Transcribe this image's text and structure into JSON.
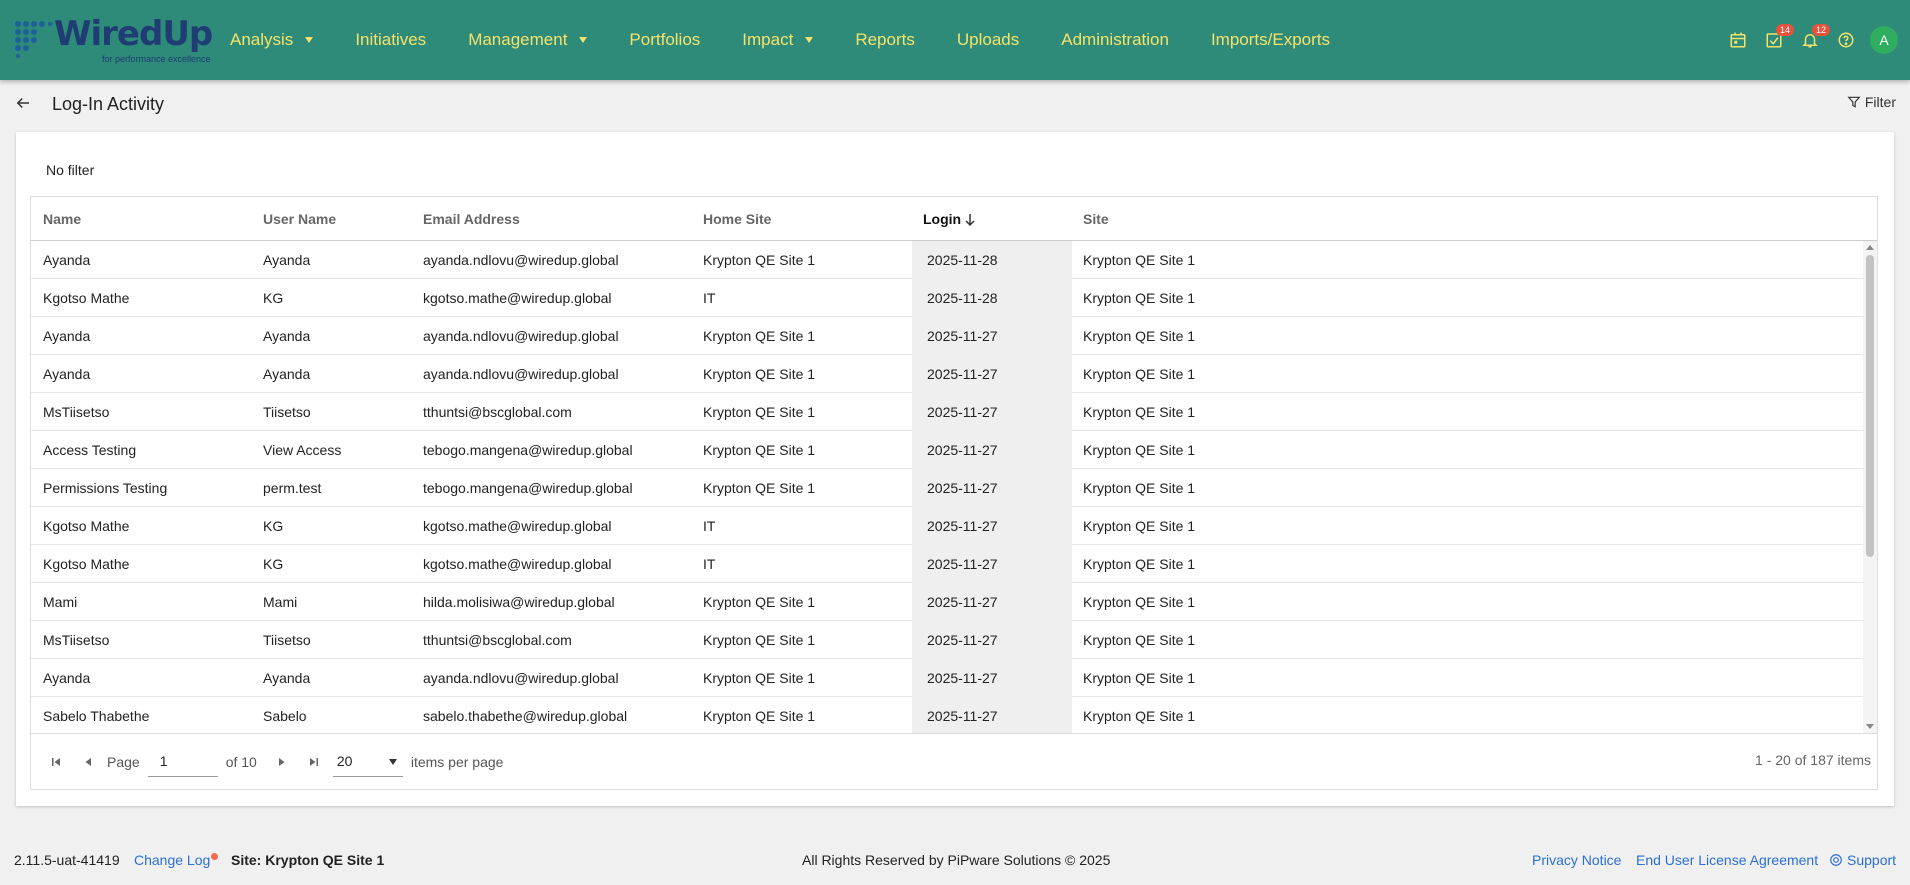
{
  "logo": {
    "text": "WiredUp",
    "tagline": "for performance excellence"
  },
  "nav": [
    {
      "label": "Analysis",
      "dropdown": true
    },
    {
      "label": "Initiatives",
      "dropdown": false
    },
    {
      "label": "Management",
      "dropdown": true
    },
    {
      "label": "Portfolios",
      "dropdown": false
    },
    {
      "label": "Impact",
      "dropdown": true
    },
    {
      "label": "Reports",
      "dropdown": false
    },
    {
      "label": "Uploads",
      "dropdown": false
    },
    {
      "label": "Administration",
      "dropdown": false
    },
    {
      "label": "Imports/Exports",
      "dropdown": false
    }
  ],
  "header_icons": {
    "calendar": "calendar-icon",
    "tasks": {
      "icon": "task-check-icon",
      "badge": "14"
    },
    "notifications": {
      "icon": "bell-icon",
      "badge": "12"
    },
    "help": "help-icon",
    "avatar_initial": "A"
  },
  "page": {
    "title": "Log-In Activity",
    "filter_label": "Filter",
    "filter_state": "No filter"
  },
  "table": {
    "columns": [
      {
        "label": "Name",
        "sorted": false
      },
      {
        "label": "User Name",
        "sorted": false
      },
      {
        "label": "Email Address",
        "sorted": false
      },
      {
        "label": "Home Site",
        "sorted": false
      },
      {
        "label": "Login",
        "sorted": true,
        "direction": "descending"
      },
      {
        "label": "Site",
        "sorted": false
      }
    ],
    "rows": [
      [
        "Ayanda",
        "Ayanda",
        "ayanda.ndlovu@wiredup.global",
        "Krypton QE Site 1",
        "2025-11-28",
        "Krypton QE Site 1"
      ],
      [
        "Kgotso Mathe",
        "KG",
        "kgotso.mathe@wiredup.global",
        "IT",
        "2025-11-28",
        "Krypton QE Site 1"
      ],
      [
        "Ayanda",
        "Ayanda",
        "ayanda.ndlovu@wiredup.global",
        "Krypton QE Site 1",
        "2025-11-27",
        "Krypton QE Site 1"
      ],
      [
        "Ayanda",
        "Ayanda",
        "ayanda.ndlovu@wiredup.global",
        "Krypton QE Site 1",
        "2025-11-27",
        "Krypton QE Site 1"
      ],
      [
        "MsTiisetso",
        "Tiisetso",
        "tthuntsi@bscglobal.com",
        "Krypton QE Site 1",
        "2025-11-27",
        "Krypton QE Site 1"
      ],
      [
        "Access Testing",
        "View Access",
        "tebogo.mangena@wiredup.global",
        "Krypton QE Site 1",
        "2025-11-27",
        "Krypton QE Site 1"
      ],
      [
        "Permissions Testing",
        "perm.test",
        "tebogo.mangena@wiredup.global",
        "Krypton QE Site 1",
        "2025-11-27",
        "Krypton QE Site 1"
      ],
      [
        "Kgotso Mathe",
        "KG",
        "kgotso.mathe@wiredup.global",
        "IT",
        "2025-11-27",
        "Krypton QE Site 1"
      ],
      [
        "Kgotso Mathe",
        "KG",
        "kgotso.mathe@wiredup.global",
        "IT",
        "2025-11-27",
        "Krypton QE Site 1"
      ],
      [
        "Mami",
        "Mami",
        "hilda.molisiwa@wiredup.global",
        "Krypton QE Site 1",
        "2025-11-27",
        "Krypton QE Site 1"
      ],
      [
        "MsTiisetso",
        "Tiisetso",
        "tthuntsi@bscglobal.com",
        "Krypton QE Site 1",
        "2025-11-27",
        "Krypton QE Site 1"
      ],
      [
        "Ayanda",
        "Ayanda",
        "ayanda.ndlovu@wiredup.global",
        "Krypton QE Site 1",
        "2025-11-27",
        "Krypton QE Site 1"
      ],
      [
        "Sabelo Thabethe",
        "Sabelo",
        "sabelo.thabethe@wiredup.global",
        "Krypton QE Site 1",
        "2025-11-27",
        "Krypton QE Site 1"
      ]
    ]
  },
  "pager": {
    "page_label": "Page",
    "page_value": "1",
    "of_label": "of 10",
    "page_size": "20",
    "items_per_page_label": "items per page",
    "total": "1 - 20 of 187 items"
  },
  "footer": {
    "version": "2.11.5-uat-41419",
    "change_log": "Change Log",
    "site": "Site: Krypton QE Site 1",
    "rights": "All Rights Reserved by PiPware Solutions © 2025",
    "privacy": "Privacy Notice",
    "eula": "End User License Agreement",
    "support": "Support"
  },
  "colors": {
    "header": "#2e8b7a",
    "nav_text": "#f4e36a",
    "link": "#2a6fd6",
    "badge": "#e5533d",
    "avatar": "#2fae5f"
  }
}
